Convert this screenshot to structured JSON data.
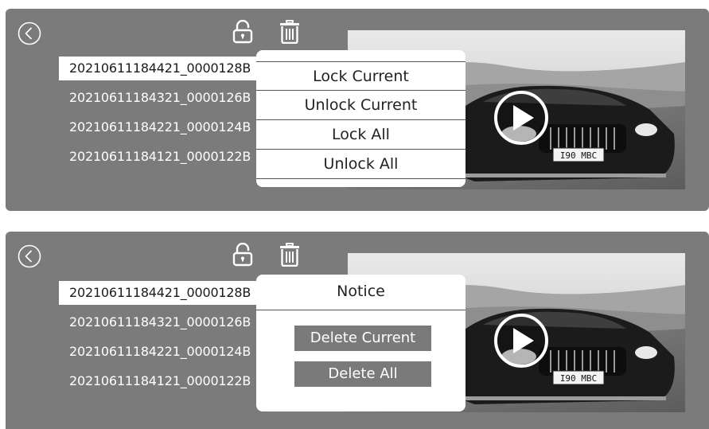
{
  "screens": [
    {
      "files": [
        "20210611184421_0000128B",
        "20210611184321_0000126B",
        "20210611184221_0000124B",
        "20210611184121_0000122B"
      ],
      "selected_index": 0,
      "menu": {
        "items": [
          "Lock Current",
          "Unlock Current",
          "Lock All",
          "Unlock All"
        ]
      }
    },
    {
      "files": [
        "20210611184421_0000128B",
        "20210611184321_0000126B",
        "20210611184221_0000124B",
        "20210611184121_0000122B"
      ],
      "selected_index": 0,
      "dialog": {
        "title": "Notice",
        "delete_current": "Delete Current",
        "delete_all": "Delete All"
      }
    }
  ],
  "plate_text": "I90 MBC",
  "icons": {
    "back": "chevron-left-circle-icon",
    "lock": "unlock-icon",
    "delete": "trash-icon",
    "play": "play-icon"
  }
}
